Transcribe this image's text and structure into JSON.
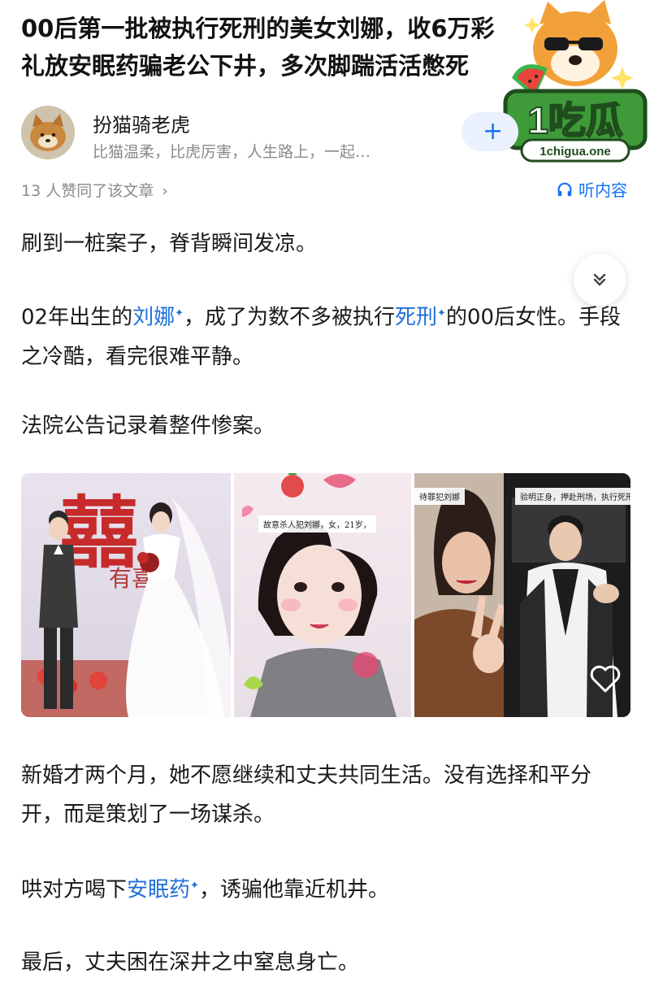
{
  "article": {
    "title": "00后第一批被执行死刑的美女刘娜，收6万彩礼放安眠药骗老公下井，多次脚踹活活憋死"
  },
  "watermark": {
    "brand": "1吃瓜",
    "domain": "1chigua.one"
  },
  "author": {
    "name": "扮猫骑老虎",
    "bio": "比猫温柔，比虎厉害，人生路上，一起…",
    "follow_symbol": "+"
  },
  "meta": {
    "likes_text": "13 人赞同了该文章",
    "chevron": "›",
    "listen_label": "听内容"
  },
  "paragraphs": {
    "p1": "刷到一桩案子，脊背瞬间发凉。",
    "p2_a": "02年出生的",
    "p2_link1": "刘娜",
    "p2_b": "，成了为数不多被执行",
    "p2_link2": "死刑",
    "p2_c": "的00后女性。手段之冷酷，看完很难平静。",
    "p3": "法院公告记录着整件惨案。",
    "p4": "新婚才两个月，她不愿继续和丈夫共同生活。没有选择和平分开，而是策划了一场谋杀。",
    "p5_a": "哄对方喝下",
    "p5_link": "安眠药",
    "p5_b": "，诱骗他靠近机井。",
    "p6": "最后，丈夫困在深井之中窒息身亡。"
  },
  "image": {
    "panel1_sign": "囍",
    "panel1_text": "有喜",
    "panel2_caption": "故意杀人犯刘娜，女，21岁，",
    "panel3_caption_a": "待罪犯刘娜",
    "panel3_caption_b": "验明正身，押赴刑场，执行死刑。"
  },
  "colors": {
    "link": "#1e6fd9",
    "accent": "#1772f6",
    "muted": "#8a8a8a"
  }
}
